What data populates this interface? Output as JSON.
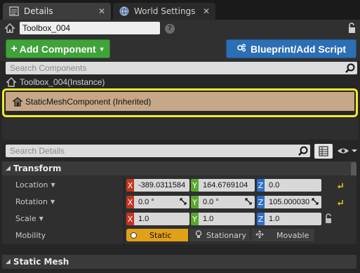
{
  "tabs": [
    {
      "label": "Details",
      "icon": "details-icon"
    },
    {
      "label": "World Settings",
      "icon": "globe-icon"
    }
  ],
  "actor": {
    "name": "Toolbox_004"
  },
  "toolbar": {
    "add_component": "Add Component",
    "blueprint_script": "Blueprint/Add Script"
  },
  "components": {
    "search_placeholder": "Search Components",
    "root": "Toolbox_004(Instance)",
    "selected": "StaticMeshComponent (Inherited)"
  },
  "details": {
    "search_placeholder": "Search Details"
  },
  "transform": {
    "title": "Transform",
    "location": {
      "label": "Location",
      "x": "-389.0311584",
      "y": "164.6769104",
      "z": "0.0"
    },
    "rotation": {
      "label": "Rotation",
      "x": "0.0 °",
      "y": "0.0 °",
      "z": "105.000030"
    },
    "scale": {
      "label": "Scale",
      "x": "1.0",
      "y": "1.0",
      "z": "1.0"
    },
    "mobility": {
      "label": "Mobility",
      "options": [
        "Static",
        "Stationary",
        "Movable"
      ],
      "selected": "Static"
    }
  },
  "static_mesh": {
    "title": "Static Mesh"
  },
  "axis_labels": {
    "x": "X",
    "y": "Y",
    "z": "Z"
  },
  "colors": {
    "accent_green": "#3fa33a",
    "accent_blue": "#2d6fb5",
    "selection_outline": "#f2ea2c",
    "mobility_active": "#e0a118"
  }
}
